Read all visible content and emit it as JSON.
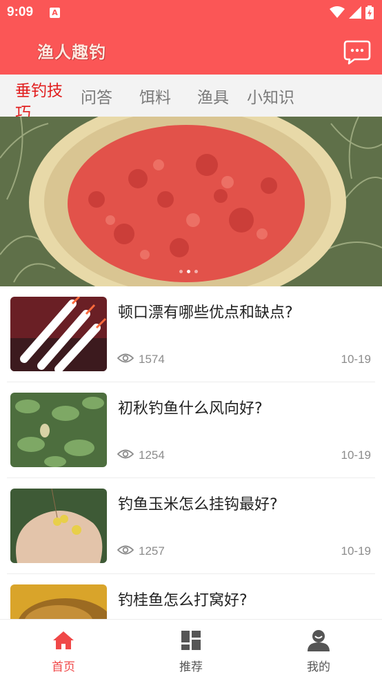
{
  "status": {
    "time": "9:09",
    "indicator": "A"
  },
  "app": {
    "title": "渔人趣钓",
    "message_icon": "chat-bubble-icon",
    "accent": "#fb5656"
  },
  "tabs": [
    {
      "label": "垂钓技巧",
      "active": true
    },
    {
      "label": "问答",
      "active": false
    },
    {
      "label": "饵料",
      "active": false
    },
    {
      "label": "渔具",
      "active": false
    },
    {
      "label": "小知识",
      "active": false
    }
  ],
  "banner": {
    "image": "red-bait-in-bowl-photo",
    "slides": 3,
    "active_slide": 2
  },
  "articles": [
    {
      "title": "顿口漂有哪些优点和缺点?",
      "views": "1574",
      "date": "10-19",
      "thumb": "fishing-floats-photo"
    },
    {
      "title": "初秋钓鱼什么风向好?",
      "views": "1254",
      "date": "10-19",
      "thumb": "lily-pad-pond-photo"
    },
    {
      "title": "钓鱼玉米怎么挂钩最好?",
      "views": "1257",
      "date": "10-19",
      "thumb": "corn-on-hook-photo"
    },
    {
      "title": "钓桂鱼怎么打窝好?",
      "views": "",
      "date": "",
      "thumb": "mandarin-fish-photo"
    }
  ],
  "nav": [
    {
      "label": "首页",
      "icon": "home-icon",
      "active": true
    },
    {
      "label": "推荐",
      "icon": "grid-icon",
      "active": false
    },
    {
      "label": "我的",
      "icon": "person-icon",
      "active": false
    }
  ]
}
